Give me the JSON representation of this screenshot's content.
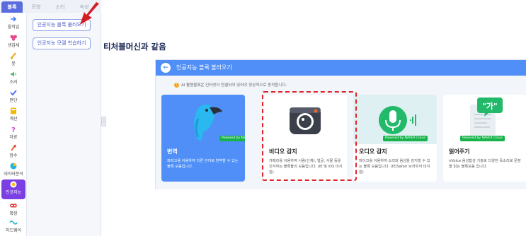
{
  "tabs": [
    "블록",
    "모양",
    "소리",
    "속성"
  ],
  "categories": [
    {
      "label": "움직임",
      "icon": "move-icon",
      "color": "#4a7cf7"
    },
    {
      "label": "생김새",
      "icon": "looks-icon",
      "color": "#e04a8a"
    },
    {
      "label": "붓",
      "icon": "brush-icon",
      "color": "#f0a020"
    },
    {
      "label": "소리",
      "icon": "sound-icon",
      "color": "#3bbf55"
    },
    {
      "label": "판단",
      "icon": "judge-icon",
      "color": "#4a6cf7"
    },
    {
      "label": "계산",
      "icon": "calc-icon",
      "color": "#f5b800"
    },
    {
      "label": "자료",
      "icon": "data-icon",
      "color": "#d04ad0"
    },
    {
      "label": "함수",
      "icon": "function-icon",
      "color": "#f06a2a"
    },
    {
      "label": "데이터분석",
      "icon": "data-analysis-icon",
      "color": "#23b5e0"
    },
    {
      "label": "인공지능",
      "icon": "ai-icon",
      "color": "#f5c028"
    },
    {
      "label": "확장",
      "icon": "extend-icon",
      "color": "#e0403a"
    },
    {
      "label": "하드웨어",
      "icon": "hardware-icon",
      "color": "#2ab0c8"
    }
  ],
  "panel_buttons": [
    "인공지능 블록 불러오기",
    "인공지능 모델 학습하기"
  ],
  "caption": "티처블머신과 같음",
  "modal": {
    "title": "인공지능 블록 불러오기",
    "notice": "AI 활용블록은 인터넷이 연결되어 있어야 정상적으로 동작합니다.",
    "cards": [
      {
        "title": "번역",
        "desc": "파파고를 이용하여 다른 언어로 번역할 수 있는 블록 모음입니다.",
        "badge": "Powered by Naver",
        "selected": true
      },
      {
        "title": "비디오 감지",
        "desc": "카메라를 이용하여 사람(신체), 얼굴, 사물 등을 인식하는 블록들의 모음입니다. (IE 및 iOS 미지원)",
        "badge": "",
        "selected": false
      },
      {
        "title": "오디오 감지",
        "desc": "마이크를 이용하여 소리와 음성을 감지할 수 있는 블록 모음입니다. (IE/Safari 브라우저 미지원)",
        "badge": "Powered by NAVER Clova",
        "selected": false
      },
      {
        "title": "읽어주기",
        "desc": "nVoice 음성합성 기술로 다양한 목소리로 문장을 읽는 블록모음 입니다.",
        "badge": "Powered by NAVER Clova",
        "selected": false
      }
    ]
  }
}
